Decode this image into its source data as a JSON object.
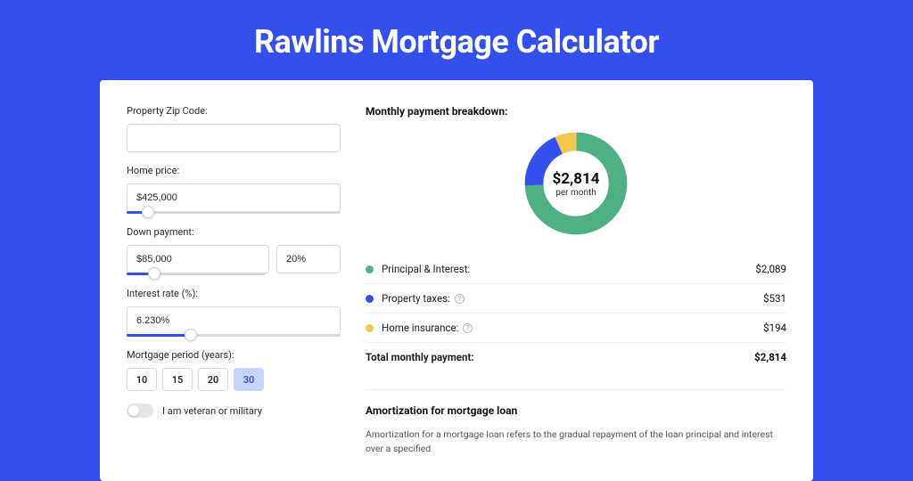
{
  "title": "Rawlins Mortgage Calculator",
  "form": {
    "zip_label": "Property Zip Code:",
    "zip_value": "",
    "home_price_label": "Home price:",
    "home_price_value": "$425,000",
    "home_price_slider_pct": 10,
    "down_payment_label": "Down payment:",
    "down_payment_value": "$85,000",
    "down_payment_pct": "20%",
    "down_payment_slider_pct": 20,
    "interest_label": "Interest rate (%):",
    "interest_value": "6.230%",
    "interest_slider_pct": 30,
    "period_label": "Mortgage period (years):",
    "periods": [
      "10",
      "15",
      "20",
      "30"
    ],
    "period_selected": "30",
    "veteran_label": "I am veteran or military"
  },
  "breakdown": {
    "title": "Monthly payment breakdown:",
    "center_amount": "$2,814",
    "center_sub": "per month",
    "items": [
      {
        "label": "Principal & Interest:",
        "value": "$2,089",
        "value_num": 2089,
        "color": "#4fb083",
        "help": false
      },
      {
        "label": "Property taxes:",
        "value": "$531",
        "value_num": 531,
        "color": "#3350ea",
        "help": true
      },
      {
        "label": "Home insurance:",
        "value": "$194",
        "value_num": 194,
        "color": "#f2c94c",
        "help": true
      }
    ],
    "total_label": "Total monthly payment:",
    "total_value": "$2,814"
  },
  "amortization": {
    "title": "Amortization for mortgage loan",
    "text": "Amortization for a mortgage loan refers to the gradual repayment of the loan principal and interest over a specified"
  },
  "chart_data": {
    "type": "pie",
    "title": "Monthly payment breakdown",
    "series": [
      {
        "name": "Principal & Interest",
        "value": 2089,
        "color": "#4fb083"
      },
      {
        "name": "Property taxes",
        "value": 531,
        "color": "#3350ea"
      },
      {
        "name": "Home insurance",
        "value": 194,
        "color": "#f2c94c"
      }
    ],
    "total": 2814,
    "center_label": "$2,814 per month"
  }
}
